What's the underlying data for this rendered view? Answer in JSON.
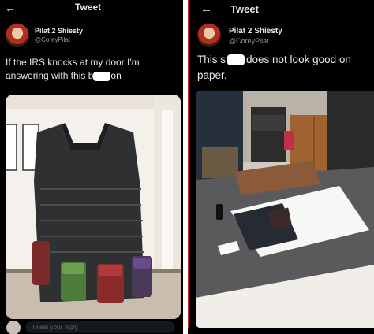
{
  "left": {
    "back_icon": "arrow-left-icon",
    "title": "Tweet",
    "user": {
      "name": "Pilat 2 Shiesty",
      "handle": "@CoreyPilat"
    },
    "more_icon": "more-horizontal-icon",
    "text_before": "If the IRS knocks at my door I'm answering with this b",
    "text_after": "on",
    "reply_placeholder": "Tweet your reply"
  },
  "right": {
    "back_icon": "arrow-left-icon",
    "title": "Tweet",
    "user": {
      "name": "Pilat 2 Shiesty",
      "handle": "@CoreyPilat"
    },
    "text_before": "This s",
    "text_after": "does not look good on paper."
  },
  "colors": {
    "background": "#000000",
    "text": "#e7e9ea",
    "secondary": "#8b98a5",
    "divider": "#d21f2a"
  }
}
